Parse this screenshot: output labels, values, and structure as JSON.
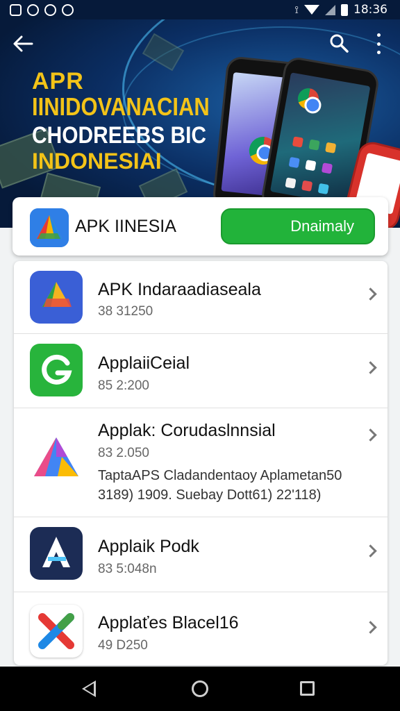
{
  "status_bar": {
    "time": "18:36"
  },
  "hero": {
    "line1": "APR",
    "line2": "IINIDOVANACIAN",
    "line3": "CHODREEBS BIC",
    "line4": "INDONESIAI"
  },
  "featured": {
    "name": "APK IINESIA",
    "button_label": "Dnaimaly"
  },
  "apps": [
    {
      "title": "APK Indaraadiaseala",
      "meta": "38 31250"
    },
    {
      "title": "ApplaiiCeial",
      "meta": "85 2:200"
    },
    {
      "title": "Applak: Corudaslnnsial",
      "meta": "83 2.050",
      "desc_line1": "TaptaAPS Cladandentaoy Aplametan50",
      "desc_line2": "3189) 1909. Suebay Dott61) 22'118)"
    },
    {
      "title": "Applaik Podk",
      "meta": "83 5:048n"
    },
    {
      "title": "Applaťes Blacel16",
      "meta": "49 D250"
    }
  ],
  "colors": {
    "accent_green": "#22b33a",
    "hero_yellow": "#f3c318",
    "hero_navy": "#0b2e63"
  },
  "icons": [
    "back-arrow-icon",
    "search-icon",
    "more-vert-icon",
    "chevron-right-icon",
    "nav-back-icon",
    "nav-home-icon",
    "nav-recents-icon"
  ]
}
